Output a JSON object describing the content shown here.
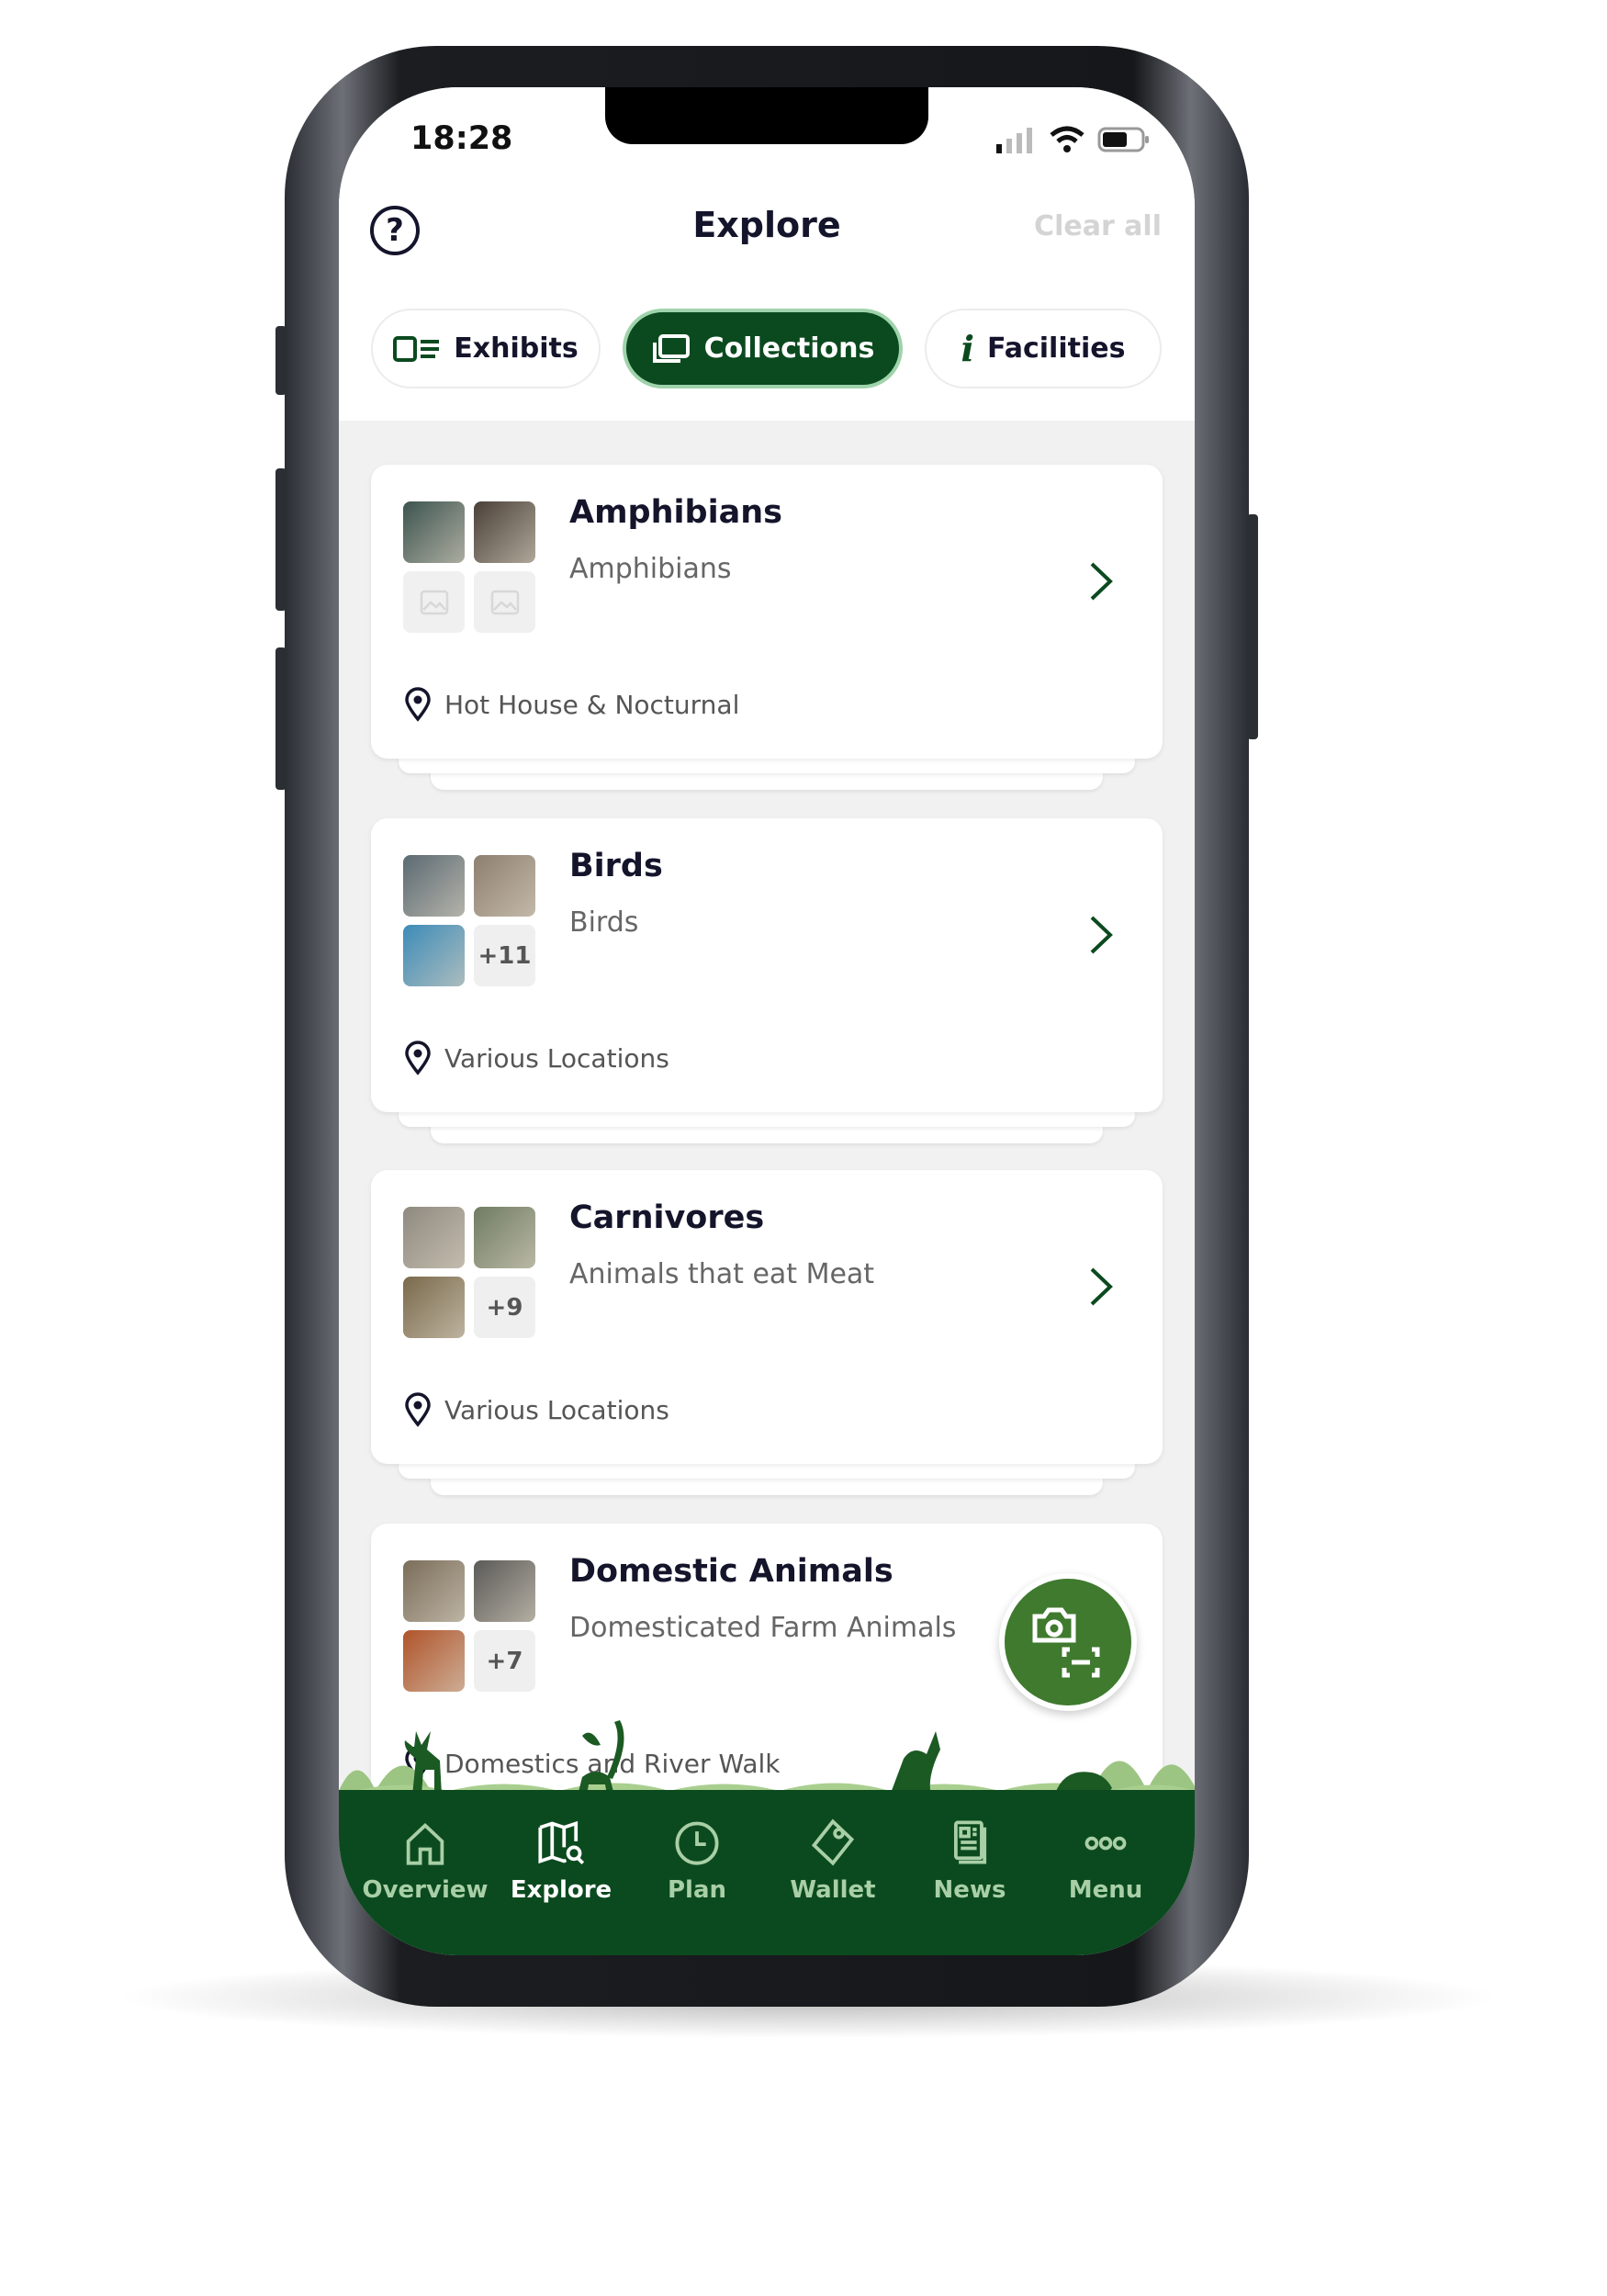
{
  "status_bar": {
    "time": "18:28"
  },
  "header": {
    "title": "Explore",
    "clear_label": "Clear all",
    "help_icon": "help-circle-icon"
  },
  "tabs": [
    {
      "label": "Exhibits",
      "icon": "list-icon",
      "active": false
    },
    {
      "label": "Collections",
      "icon": "collections-icon",
      "active": true
    },
    {
      "label": "Facilities",
      "icon": "info-icon",
      "active": false
    }
  ],
  "collections": [
    {
      "title": "Amphibians",
      "subtitle": "Amphibians",
      "location": "Hot House & Nocturnal",
      "thumbs": [
        "#3d5450",
        "#4a4038"
      ],
      "placeholders": 2,
      "more": ""
    },
    {
      "title": "Birds",
      "subtitle": "Birds",
      "location": "Various Locations",
      "thumbs": [
        "#5b6a72",
        "#8e7f70",
        "#3d8bb8"
      ],
      "placeholders": 0,
      "more": "+11"
    },
    {
      "title": "Carnivores",
      "subtitle": "Animals that eat Meat",
      "location": "Various Locations",
      "thumbs": [
        "#8f8a80",
        "#6f7c62",
        "#7a6a4c"
      ],
      "placeholders": 0,
      "more": "+9"
    },
    {
      "title": "Domestic Animals",
      "subtitle": "Domesticated Farm Animals",
      "location": "Domestics and River Walk",
      "thumbs": [
        "#7a6d5a",
        "#5b5a58",
        "#b0542a"
      ],
      "placeholders": 0,
      "more": "+7"
    }
  ],
  "fab": {
    "icon": "camera-scan-icon"
  },
  "nav": [
    {
      "label": "Overview",
      "icon": "home-icon",
      "active": false
    },
    {
      "label": "Explore",
      "icon": "map-search-icon",
      "active": true
    },
    {
      "label": "Plan",
      "icon": "clock-icon",
      "active": false
    },
    {
      "label": "Wallet",
      "icon": "wallet-icon",
      "active": false
    },
    {
      "label": "News",
      "icon": "news-icon",
      "active": false
    },
    {
      "label": "Menu",
      "icon": "more-icon",
      "active": false
    }
  ],
  "colors": {
    "brand_green": "#0b4a1f",
    "fab_green": "#3f7a2e",
    "nav_inactive": "#a9cfa6"
  }
}
